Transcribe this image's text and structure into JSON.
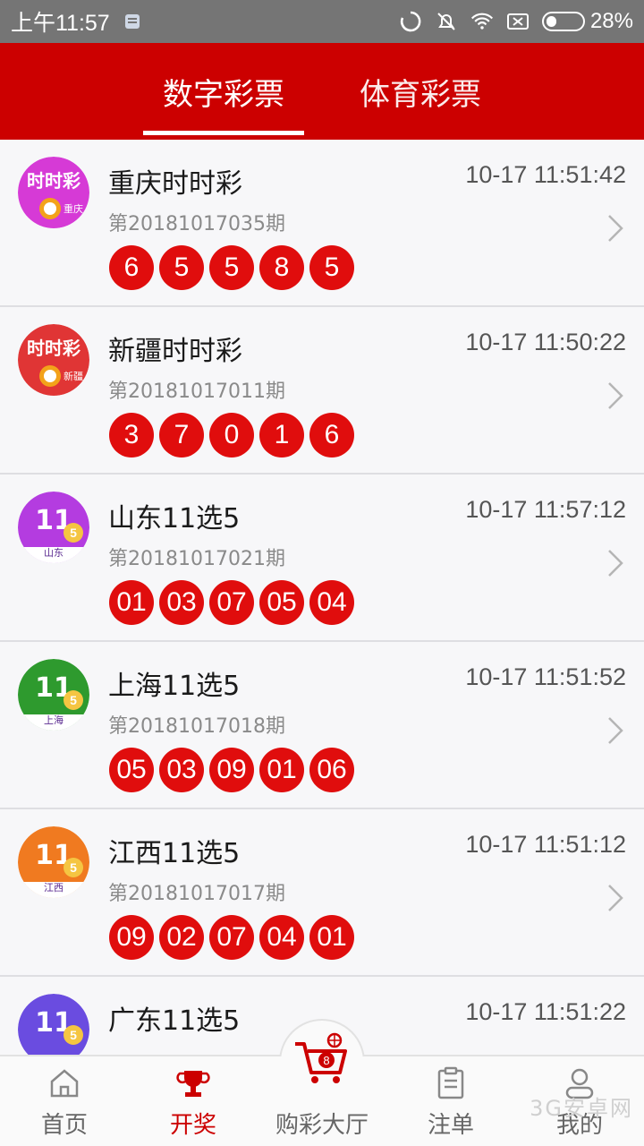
{
  "status_bar": {
    "time": "上午11:57",
    "battery": "28%"
  },
  "tabs": [
    {
      "label": "数字彩票"
    },
    {
      "label": "体育彩票"
    }
  ],
  "lotteries": [
    {
      "name": "重庆时时彩",
      "time": "10-17 11:51:42",
      "issue": "第20181017035期",
      "numbers": [
        "6",
        "5",
        "5",
        "8",
        "5"
      ],
      "logo_text": "时时彩",
      "logo_region": "重庆"
    },
    {
      "name": "新疆时时彩",
      "time": "10-17 11:50:22",
      "issue": "第20181017011期",
      "numbers": [
        "3",
        "7",
        "0",
        "1",
        "6"
      ],
      "logo_text": "时时彩",
      "logo_region": "新疆"
    },
    {
      "name": "山东11选5",
      "time": "10-17 11:57:12",
      "issue": "第20181017021期",
      "numbers": [
        "01",
        "03",
        "07",
        "05",
        "04"
      ],
      "logo_text": "11",
      "logo_region": "山东"
    },
    {
      "name": "上海11选5",
      "time": "10-17 11:51:52",
      "issue": "第20181017018期",
      "numbers": [
        "05",
        "03",
        "09",
        "01",
        "06"
      ],
      "logo_text": "11",
      "logo_region": "上海"
    },
    {
      "name": "江西11选5",
      "time": "10-17 11:51:12",
      "issue": "第20181017017期",
      "numbers": [
        "09",
        "02",
        "07",
        "04",
        "01"
      ],
      "logo_text": "11",
      "logo_region": "江西"
    },
    {
      "name": "广东11选5",
      "time": "10-17 11:51:22",
      "issue": "",
      "numbers": [],
      "logo_text": "11",
      "logo_region": ""
    }
  ],
  "bottom_nav": {
    "home": "首页",
    "draw": "开奖",
    "lobby": "购彩大厅",
    "bets": "注单",
    "mine": "我的"
  },
  "watermark": "3G安卓网",
  "colors": {
    "header_red": "#cc0000",
    "ball_red": "#e00d0d",
    "active_nav": "#cc0000"
  }
}
